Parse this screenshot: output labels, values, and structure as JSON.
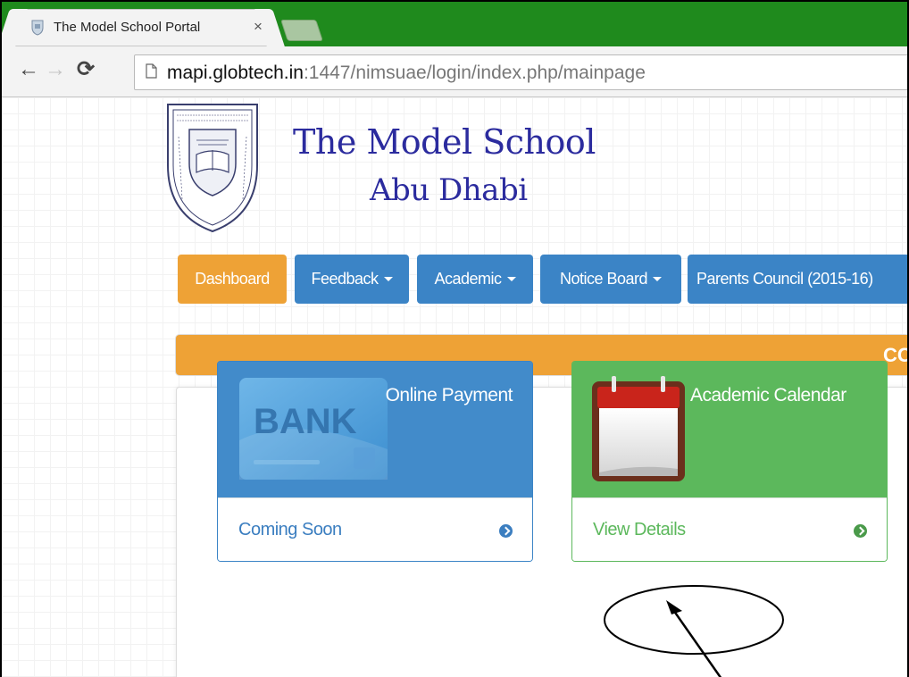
{
  "browser": {
    "tab_title": "The Model School Portal",
    "tab_close": "×",
    "url_host": "mapi.globtech.in",
    "url_rest": ":1447/nimsuae/login/index.php/mainpage"
  },
  "header": {
    "school_name": "The Model School",
    "school_city": "Abu Dhabi",
    "logo_text": "READ IN THE NAME OF THY LORD AND CHERISHER WHO CREATED · THE MODEL SCHOOL"
  },
  "nav": {
    "dashboard": "Dashboard",
    "feedback": "Feedback",
    "academic": "Academic",
    "notice_board": "Notice Board",
    "parents_council": "Parents Council (2015-16)"
  },
  "marquee": {
    "text": "CC"
  },
  "cards": {
    "payment": {
      "title": "Online Payment",
      "footer": "Coming Soon",
      "image_text": "BANK"
    },
    "calendar": {
      "title": "Academic Calendar",
      "footer": "View Details"
    }
  },
  "colors": {
    "tabstrip": "#1f8a1d",
    "primary": "#428bca",
    "warning": "#eea236",
    "success": "#5cb85c",
    "school_text": "#2b2b9e"
  }
}
